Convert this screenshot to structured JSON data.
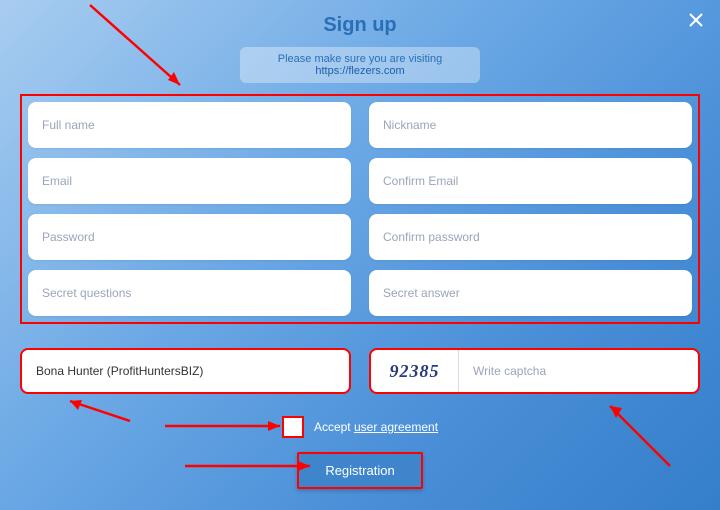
{
  "title": "Sign up",
  "notice": {
    "text": "Please make sure you are visiting",
    "url": "https://flezers.com"
  },
  "fields": {
    "fullname": {
      "placeholder": "Full name"
    },
    "nickname": {
      "placeholder": "Nickname"
    },
    "email": {
      "placeholder": "Email"
    },
    "confirm_email": {
      "placeholder": "Confirm Email"
    },
    "password": {
      "placeholder": "Password"
    },
    "confirm_password": {
      "placeholder": "Confirm password"
    },
    "secret_q": {
      "placeholder": "Secret questions"
    },
    "secret_a": {
      "placeholder": "Secret answer"
    }
  },
  "upline": {
    "value": "Bona Hunter (ProfitHuntersBIZ)"
  },
  "captcha": {
    "code": "92385",
    "placeholder": "Write captcha"
  },
  "agreement": {
    "accept": "Accept",
    "link": "user agreement"
  },
  "submit": "Registration"
}
